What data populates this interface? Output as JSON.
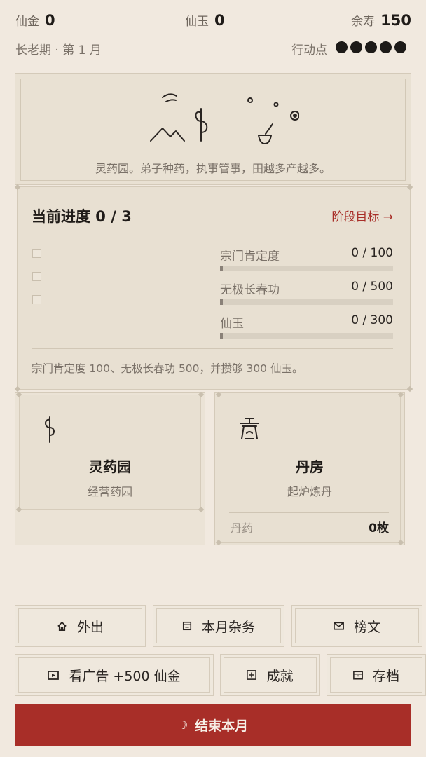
{
  "status": {
    "gold_label": "仙金",
    "gold_value": "0",
    "jade_label": "仙玉",
    "jade_value": "0",
    "life_label": "余寿",
    "life_value": "150",
    "period": "长老期 · 第 1 月",
    "action_label": "行动点",
    "action_points": 5
  },
  "banner": {
    "caption": "灵药园。弟子种药，执事管事，田越多产越多。"
  },
  "progress": {
    "title": "当前进度 0 / 3",
    "goal_link": "阶段目标 →",
    "items": [
      {
        "label": "宗门肯定度",
        "value": "0 / 100",
        "current": 0,
        "target": 100
      },
      {
        "label": "无极长春功",
        "value": "0 / 500",
        "current": 0,
        "target": 500
      },
      {
        "label": "仙玉",
        "value": "0 / 300",
        "current": 0,
        "target": 300
      }
    ],
    "description": "宗门肯定度 100、无极长春功 500，并攒够 300 仙玉。"
  },
  "buildings": [
    {
      "title": "灵药园",
      "subtitle": "经营药园",
      "icon": "herb-icon"
    },
    {
      "title": "丹房",
      "subtitle": "起炉炼丹",
      "icon": "cauldron-icon",
      "stat_label": "丹药",
      "stat_value": "0枚"
    }
  ],
  "actions": {
    "go_out": "外出",
    "monthly_tasks": "本月杂务",
    "notices": "榜文",
    "watch_ad": "看广告 +500 仙金",
    "achievements": "成就",
    "save": "存档",
    "end_month": "结束本月"
  },
  "colors": {
    "background": "#f1e9df",
    "accent_red": "#a82e28",
    "panel": "#e9e1d3"
  }
}
